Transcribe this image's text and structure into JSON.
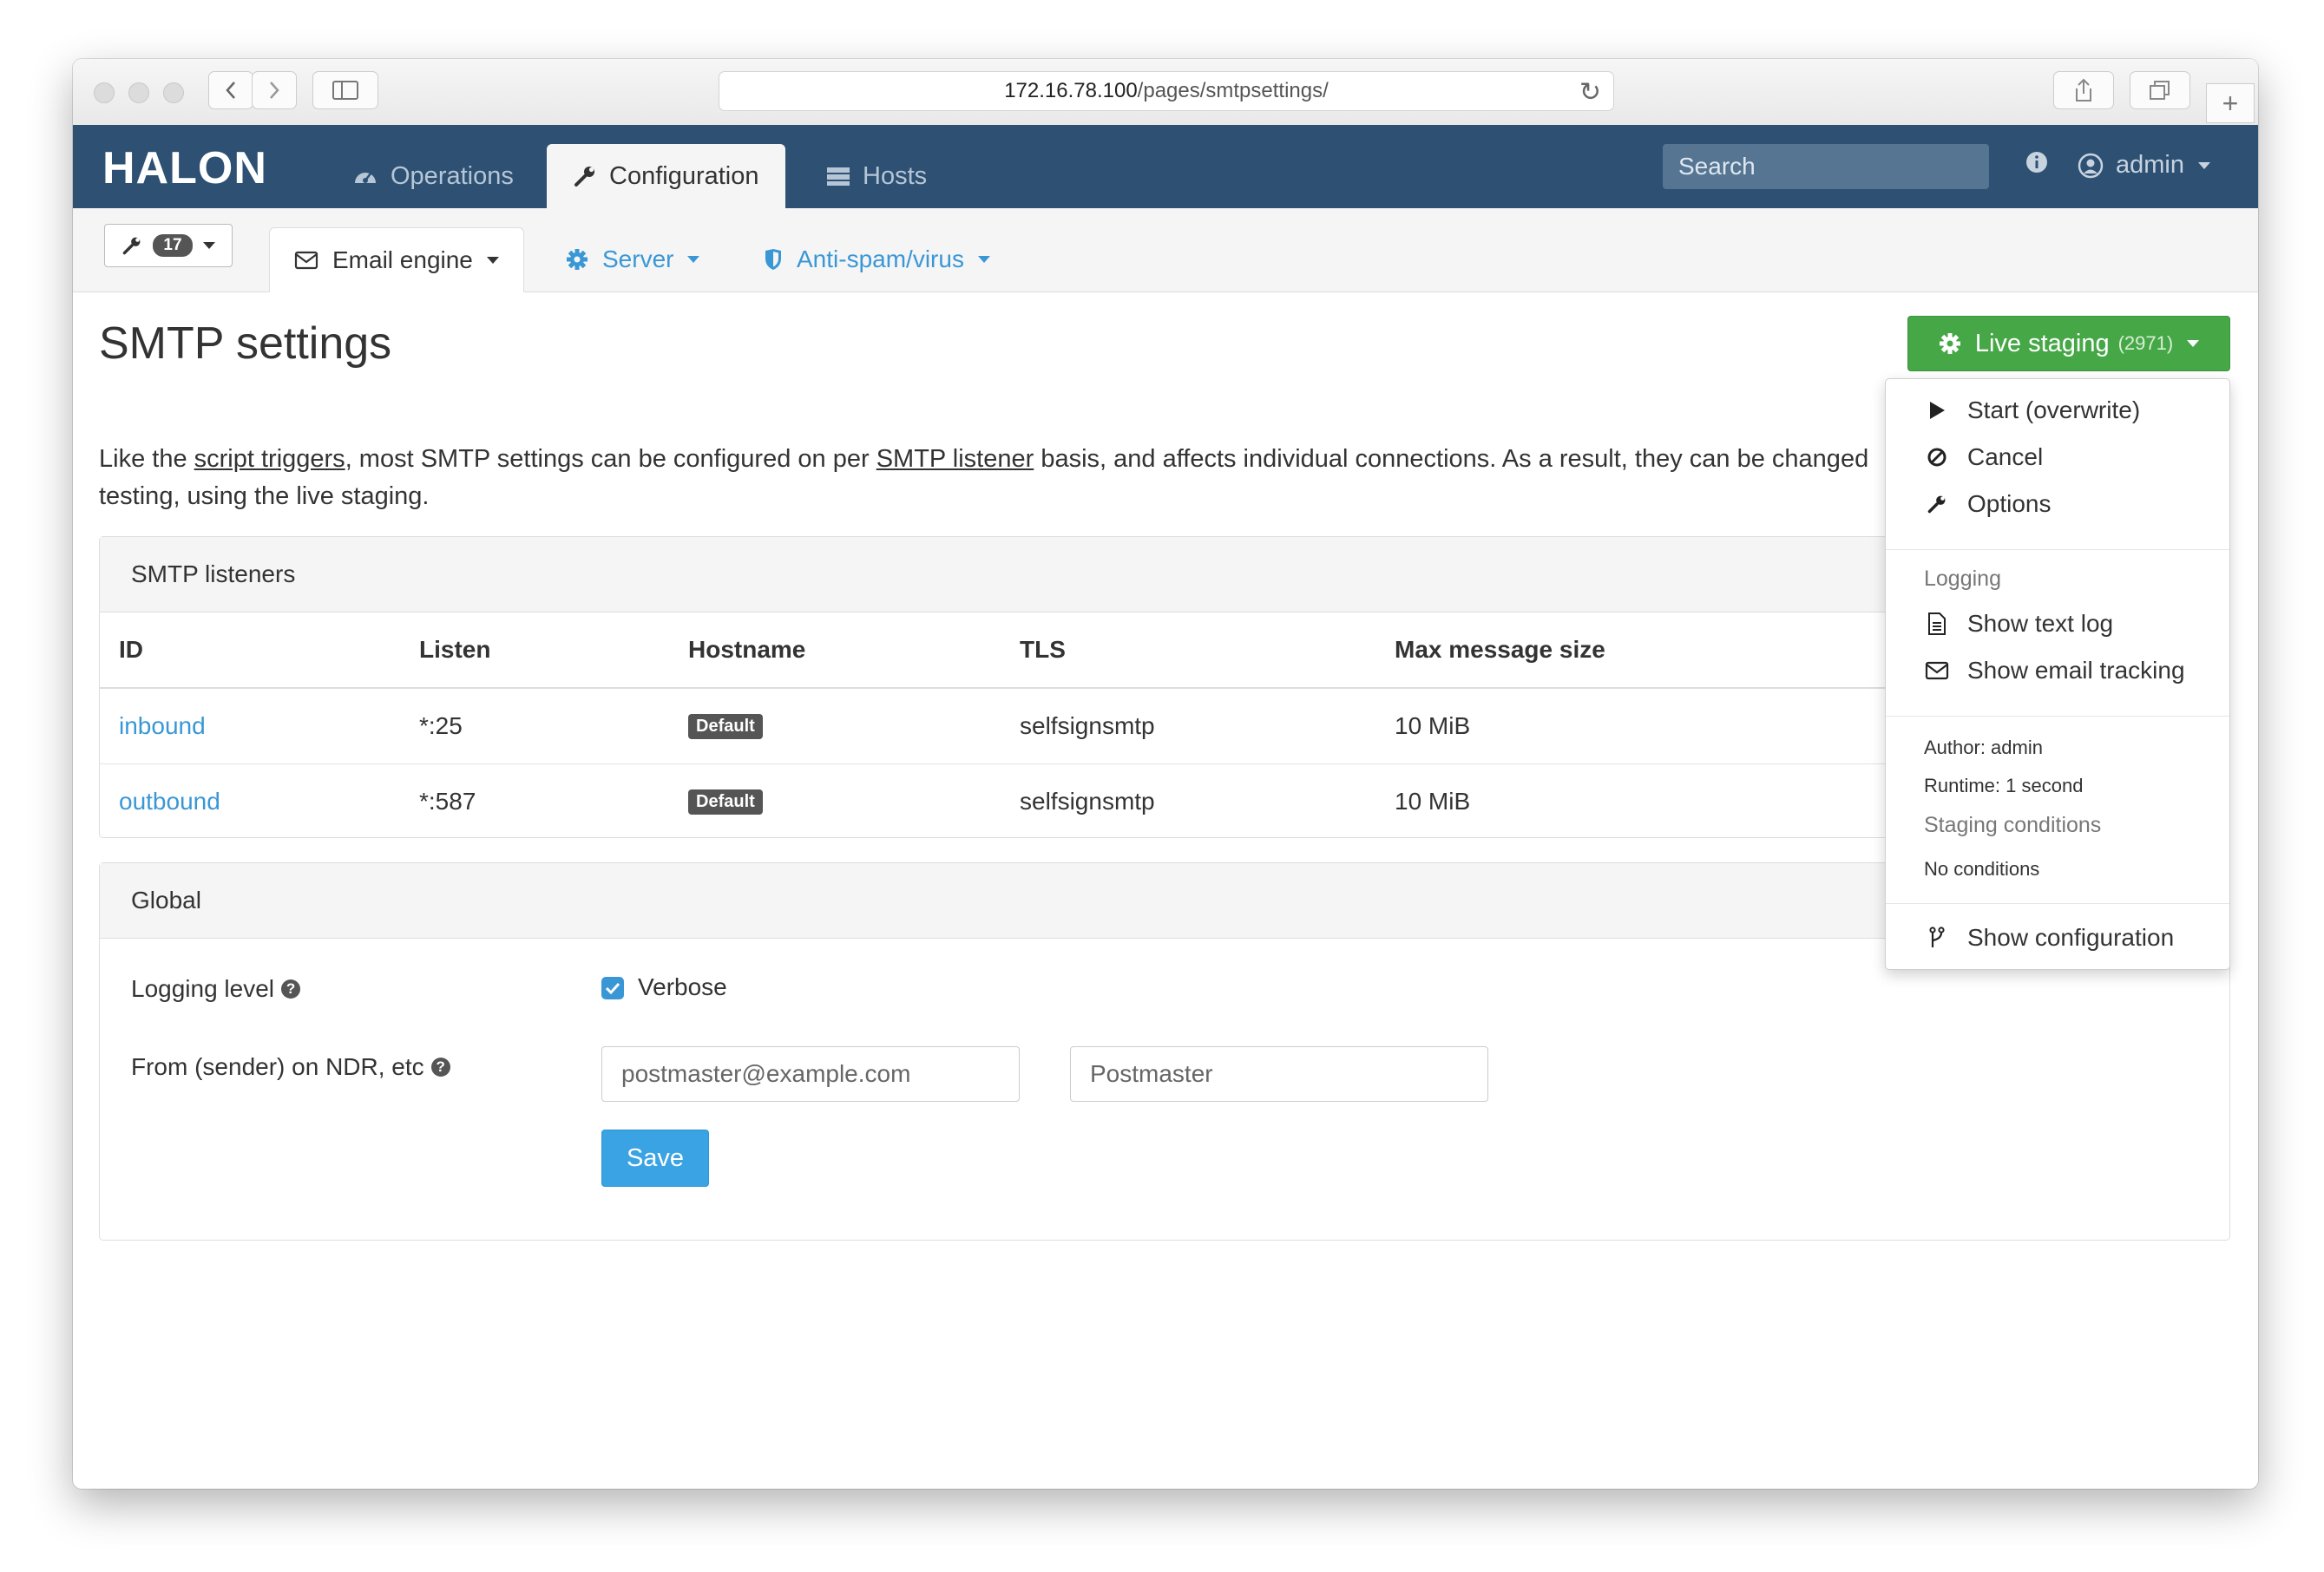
{
  "browser": {
    "url_host": "172.16.78.100",
    "url_path": "/pages/smtpsettings/"
  },
  "navbar": {
    "logo": "HALON",
    "tabs": [
      {
        "label": "Operations",
        "icon": "dashboard-icon"
      },
      {
        "label": "Configuration",
        "icon": "wrench-icon",
        "active": true
      },
      {
        "label": "Hosts",
        "icon": "server-icon"
      }
    ],
    "search_placeholder": "Search",
    "user": "admin"
  },
  "subnav": {
    "revision_count": "17",
    "tabs": [
      {
        "label": "Email engine",
        "icon": "envelope-icon",
        "active": true
      },
      {
        "label": "Server",
        "icon": "gear-icon"
      },
      {
        "label": "Anti-spam/virus",
        "icon": "shield-icon"
      }
    ]
  },
  "page": {
    "title": "SMTP settings",
    "intro_1": "Like the ",
    "intro_link_1": "script triggers",
    "intro_2": ", most SMTP settings can be configured on per ",
    "intro_link_2": "SMTP listener",
    "intro_3": " basis, and affects individual connections. As a result, they can be changed",
    "intro_4": "testing, using the live staging."
  },
  "live_staging": {
    "label": "Live staging",
    "count": "(2971)"
  },
  "listeners": {
    "heading": "SMTP listeners",
    "columns": [
      "ID",
      "Listen",
      "Hostname",
      "TLS",
      "Max message size"
    ],
    "rows": [
      {
        "id": "inbound",
        "listen": "*:25",
        "hostname": "Default",
        "tls": "selfsignsmtp",
        "max": "10 MiB"
      },
      {
        "id": "outbound",
        "listen": "*:587",
        "hostname": "Default",
        "tls": "selfsignsmtp",
        "max": "10 MiB"
      }
    ]
  },
  "global": {
    "heading": "Global",
    "logging_label": "Logging level",
    "verbose_label": "Verbose",
    "verbose_checked": true,
    "from_label": "From (sender) on NDR, etc",
    "email_placeholder": "postmaster@example.com",
    "name_placeholder": "Postmaster",
    "save_label": "Save"
  },
  "dropdown": {
    "start": "Start (overwrite)",
    "cancel": "Cancel",
    "options": "Options",
    "logging_header": "Logging",
    "show_text_log": "Show text log",
    "show_email_tracking": "Show email tracking",
    "author": "Author: admin",
    "runtime": "Runtime: 1 second",
    "staging_header": "Staging conditions",
    "no_conditions": "No conditions",
    "show_configuration": "Show configuration"
  },
  "colors": {
    "navbar": "#2d5073",
    "link": "#3a97d6",
    "live_staging": "#46a747",
    "save": "#3aa3e3"
  }
}
